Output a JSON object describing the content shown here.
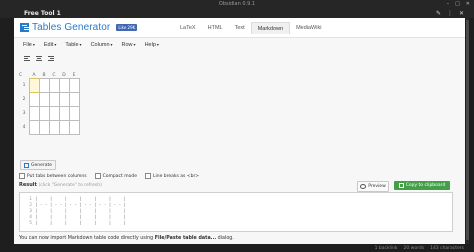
{
  "window": {
    "title": "Obsidian 0.9.1",
    "pane_title": "Free Tool 1"
  },
  "app": {
    "logo_text": "Tables Generator",
    "like_label": "Like 29K",
    "formats": [
      "LaTeX",
      "HTML",
      "Text",
      "Markdown",
      "MediaWiki"
    ],
    "active_format": "Markdown",
    "menu": [
      "File",
      "Edit",
      "Table",
      "Column",
      "Row",
      "Help"
    ],
    "grid": {
      "corner": "C",
      "columns": [
        "A",
        "B",
        "C",
        "D",
        "E"
      ],
      "rows": [
        "1",
        "2",
        "3",
        "4"
      ]
    },
    "generate_label": "Generate",
    "options": [
      "Put tabs between columns",
      "Compact mode",
      "Line breaks as <br>"
    ],
    "result": {
      "label": "Result",
      "hint": "(click \"Generate\" to refresh)",
      "preview_label": "Preview",
      "copy_label": "Copy to clipboard",
      "lines": [
        {
          "n": "1",
          "text": "|  |  |  |  |  |  |"
        },
        {
          "n": "2",
          "text": "|--|--|--|--|--|--|"
        },
        {
          "n": "3",
          "text": "|  |  |  |  |  |  |"
        },
        {
          "n": "4",
          "text": "|  |  |  |  |  |  |"
        },
        {
          "n": "5",
          "text": "|  |  |  |  |  |  |"
        }
      ]
    },
    "note_prefix": "You can now import Markdown table code directly using ",
    "note_bold": "File/Paste table data...",
    "note_suffix": " dialog."
  },
  "status": {
    "backlinks": "1 backlink",
    "words": "20 words",
    "chars": "143 characters"
  }
}
